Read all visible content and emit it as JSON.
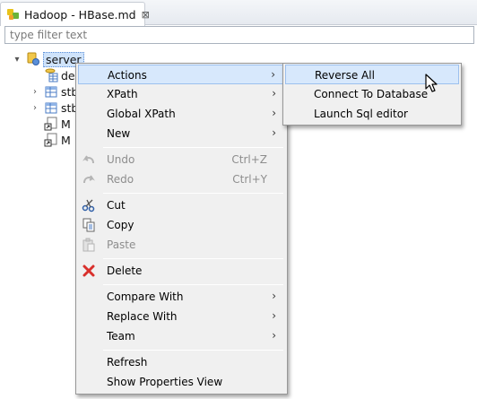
{
  "editor_tab": {
    "title": "Hadoop - HBase.md",
    "close": "⊠"
  },
  "filter": {
    "placeholder": "type filter text",
    "value": ""
  },
  "tree": {
    "root": {
      "label": "server",
      "twisty": "▾"
    },
    "children": [
      {
        "label": "de",
        "twisty": ""
      },
      {
        "label": "stb",
        "twisty": "›"
      },
      {
        "label": "stb",
        "twisty": "›"
      },
      {
        "label": "M",
        "twisty": ""
      },
      {
        "label": "M",
        "twisty": ""
      }
    ]
  },
  "context_menu": {
    "items": [
      {
        "label": "Actions",
        "submenu": "›",
        "highlighted": true
      },
      {
        "label": "XPath",
        "submenu": "›"
      },
      {
        "label": "Global XPath",
        "submenu": "›"
      },
      {
        "label": "New",
        "submenu": "›"
      },
      {
        "label": "Undo",
        "shortcut": "Ctrl+Z",
        "disabled": true
      },
      {
        "label": "Redo",
        "shortcut": "Ctrl+Y",
        "disabled": true
      },
      {
        "label": "Cut"
      },
      {
        "label": "Copy"
      },
      {
        "label": "Paste",
        "disabled": true
      },
      {
        "label": "Delete"
      },
      {
        "label": "Compare With",
        "submenu": "›"
      },
      {
        "label": "Replace With",
        "submenu": "›"
      },
      {
        "label": "Team",
        "submenu": "›"
      },
      {
        "label": "Refresh"
      },
      {
        "label": "Show Properties View"
      }
    ]
  },
  "actions_submenu": {
    "items": [
      {
        "label": "Reverse All",
        "highlighted": true
      },
      {
        "label": "Connect To Database"
      },
      {
        "label": "Launch Sql editor"
      }
    ]
  },
  "colors": {
    "menu_bg": "#f0f0f0",
    "highlight": "#d7e8fc",
    "selection": "#cfe3fb",
    "disabled_text": "#8d8d8d",
    "delete_icon": "#d9302c"
  }
}
